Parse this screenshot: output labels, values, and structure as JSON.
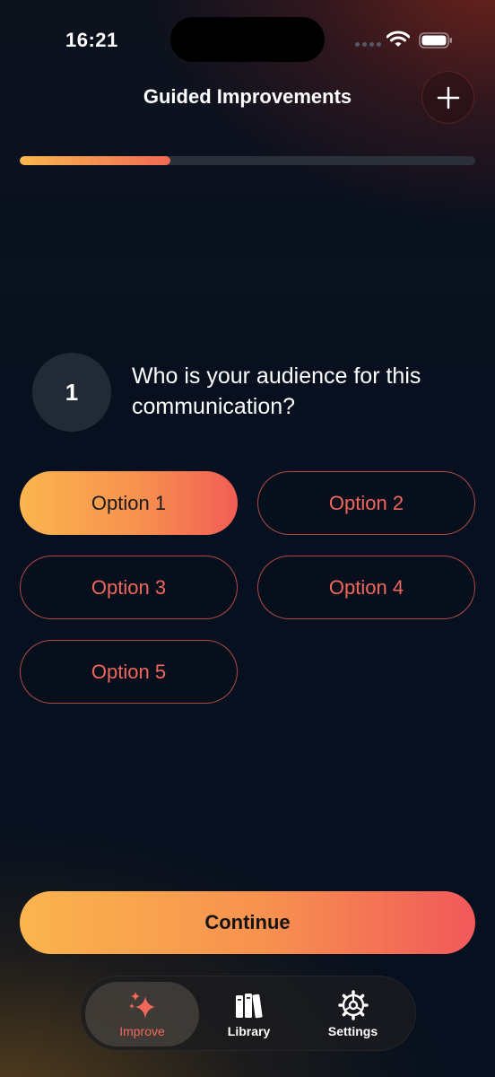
{
  "status_bar": {
    "time": "16:21"
  },
  "header": {
    "title": "Guided Improvements",
    "add_icon": "plus-icon"
  },
  "progress": {
    "fraction": 0.33
  },
  "question": {
    "number": "1",
    "text": "Who is your audience for this communication?"
  },
  "options": [
    {
      "label": "Option 1",
      "selected": true
    },
    {
      "label": "Option 2",
      "selected": false
    },
    {
      "label": "Option 3",
      "selected": false
    },
    {
      "label": "Option 4",
      "selected": false
    },
    {
      "label": "Option 5",
      "selected": false
    }
  ],
  "continue_label": "Continue",
  "tabbar": {
    "items": [
      {
        "label": "Improve",
        "icon": "sparkles-icon",
        "active": true
      },
      {
        "label": "Library",
        "icon": "books-icon",
        "active": false
      },
      {
        "label": "Settings",
        "icon": "gear-icon",
        "active": false
      }
    ]
  },
  "colors": {
    "accent": "#f0675b",
    "gradient_start": "#fbb54e",
    "gradient_end": "#f25d55"
  }
}
